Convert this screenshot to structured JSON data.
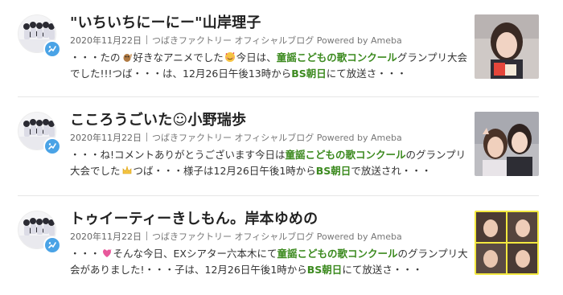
{
  "entries": [
    {
      "title": "\"いちいちにーにー\"山岸理子",
      "date": "2020年11月22日",
      "blog": "つばきファクトリー オフィシャルブログ Powered by Ameba",
      "excerpt": {
        "p1": "・・・たの",
        "p2": "好きなアニメでした",
        "p3": "今日は、",
        "kw1": "童謡こどもの歌コンクール",
        "p4": "グランプリ大会でした!!!つば・・・は、12月26日午後13時から",
        "kw2": "BS朝日",
        "p5": "にて放送さ・・・"
      },
      "emoji1": "chipmunk-emoji",
      "emoji2": "smiling-face-with-hearts-emoji"
    },
    {
      "title": "こころうごいた☺︎小野瑞歩",
      "date": "2020年11月22日",
      "blog": "つばきファクトリー オフィシャルブログ Powered by Ameba",
      "excerpt": {
        "p1": "・・・ね!コメントありがとうございます今日は",
        "kw1": "童謡こどもの歌コンクール",
        "p2": "のグランプリ大会でした",
        "p3": "つば・・・様子は12月26日午後1時から",
        "kw2": "BS朝日",
        "p4": "で放送され・・・"
      },
      "emoji1": "crown-emoji"
    },
    {
      "title": "トゥイーティーきしもん。岸本ゆめの",
      "date": "2020年11月22日",
      "blog": "つばきファクトリー オフィシャルブログ Powered by Ameba",
      "excerpt": {
        "p1": "・・・",
        "p2": "そんな今日、EXシアター六本木にて",
        "kw1": "童謡こどもの歌コンクール",
        "p3": "のグランプリ大会がありました!・・・子は、12月26日午後1時から",
        "kw2": "BS朝日",
        "p4": "にて放送さ・・・"
      },
      "emoji1": "pink-heart-emoji"
    }
  ],
  "colors": {
    "keyword": "#3c8a1f",
    "badge": "#4aa3e6",
    "divider": "#e6e6e6"
  },
  "icons": {
    "badge": "blog-badge-icon"
  }
}
